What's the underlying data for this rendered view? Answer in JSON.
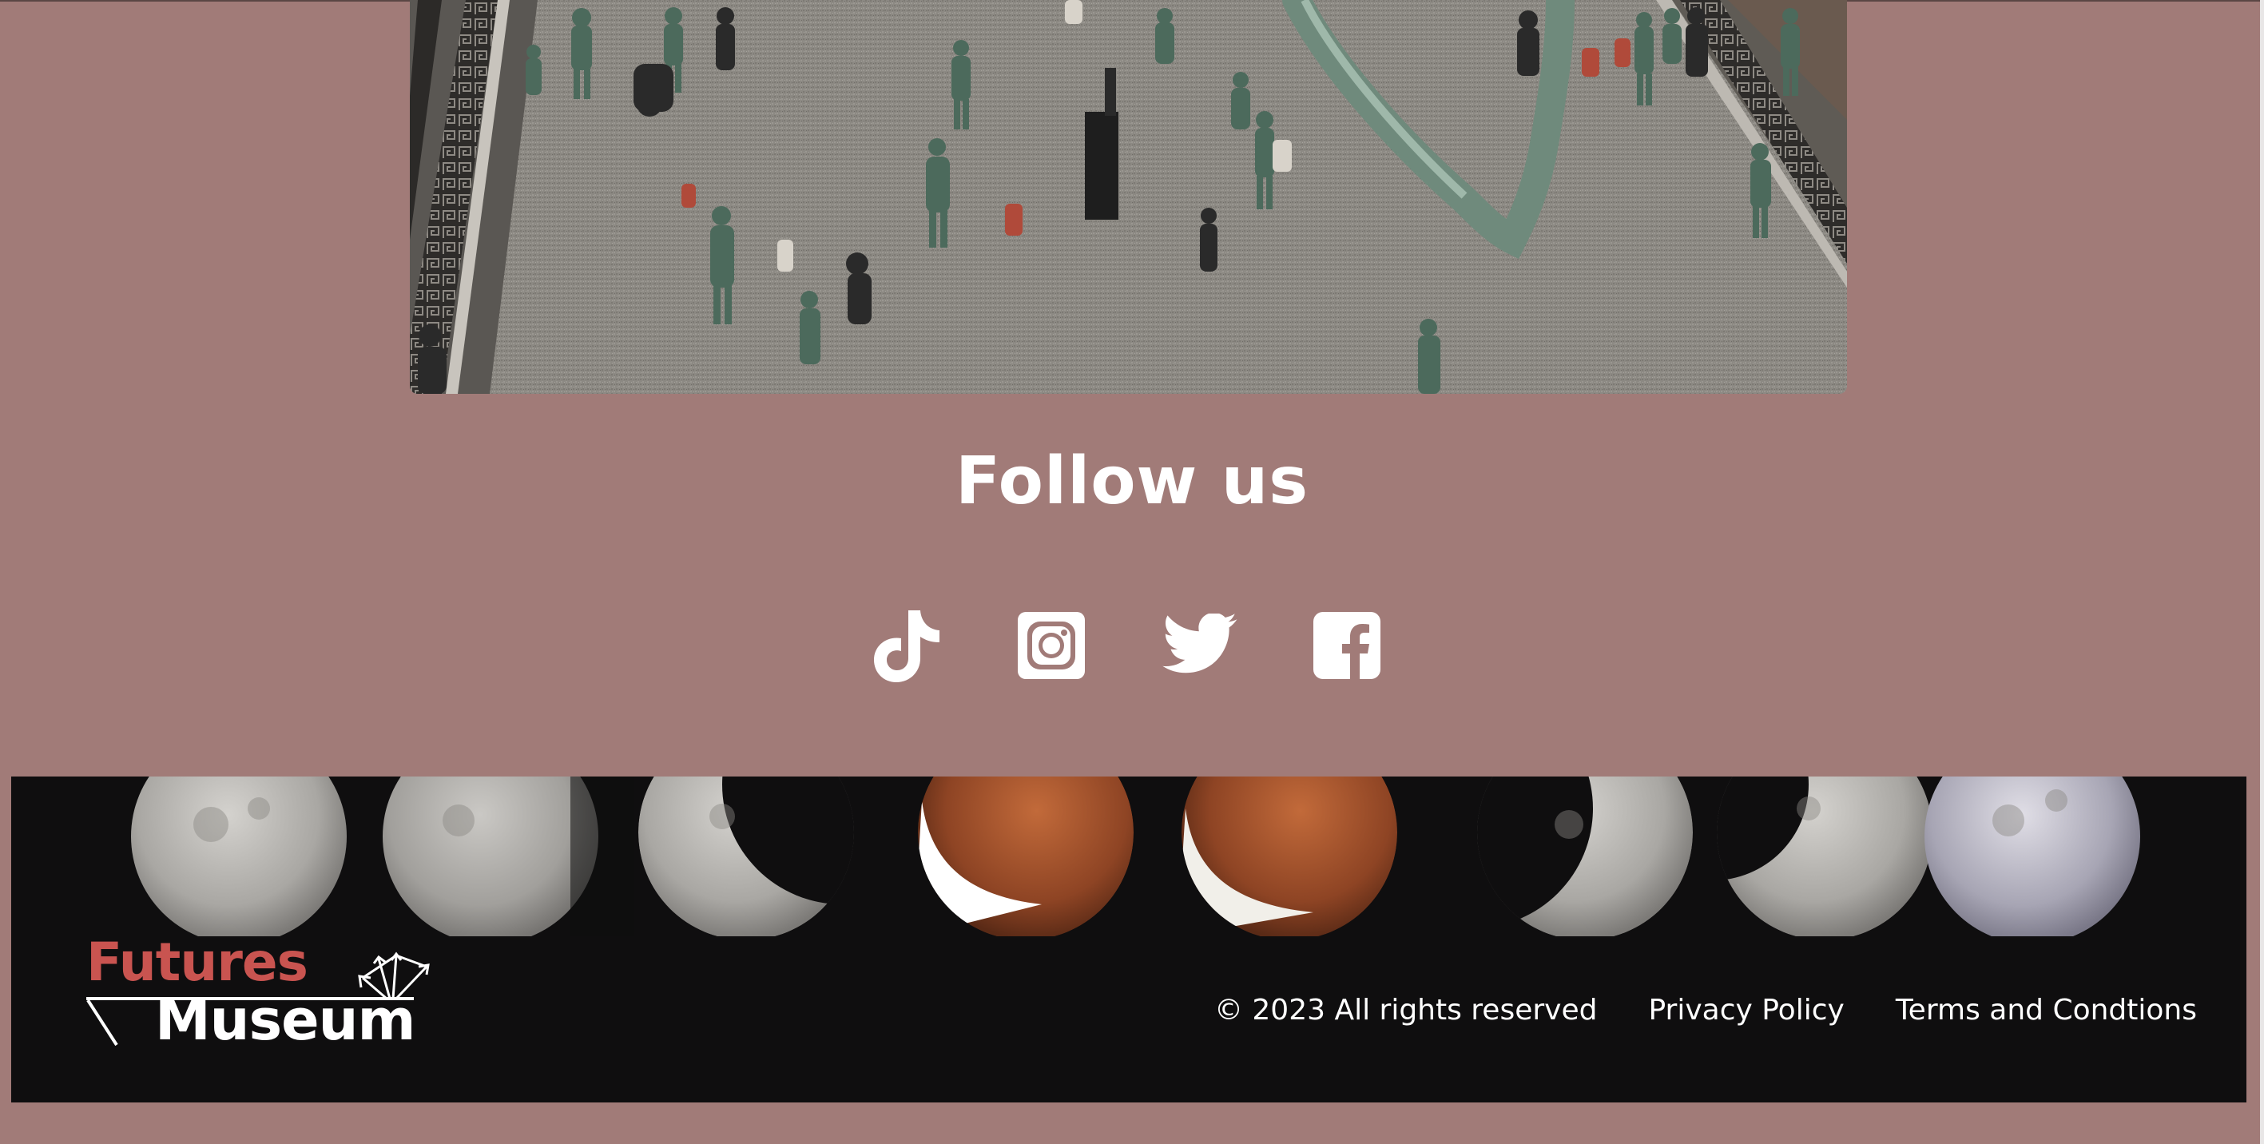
{
  "follow": {
    "title": "Follow us",
    "icons": [
      "tiktok-icon",
      "instagram-icon",
      "twitter-icon",
      "facebook-icon"
    ]
  },
  "footer": {
    "logo": {
      "line1": "Futures",
      "line2": "Museum"
    },
    "copyright": "© 2023 All rights reserved",
    "links": [
      "Privacy Policy",
      "Terms and Condtions"
    ]
  },
  "colors": {
    "page_background": "#a17b78",
    "footer_background": "#0f0e0f",
    "logo_accent": "#c95450",
    "text": "#ffffff"
  }
}
